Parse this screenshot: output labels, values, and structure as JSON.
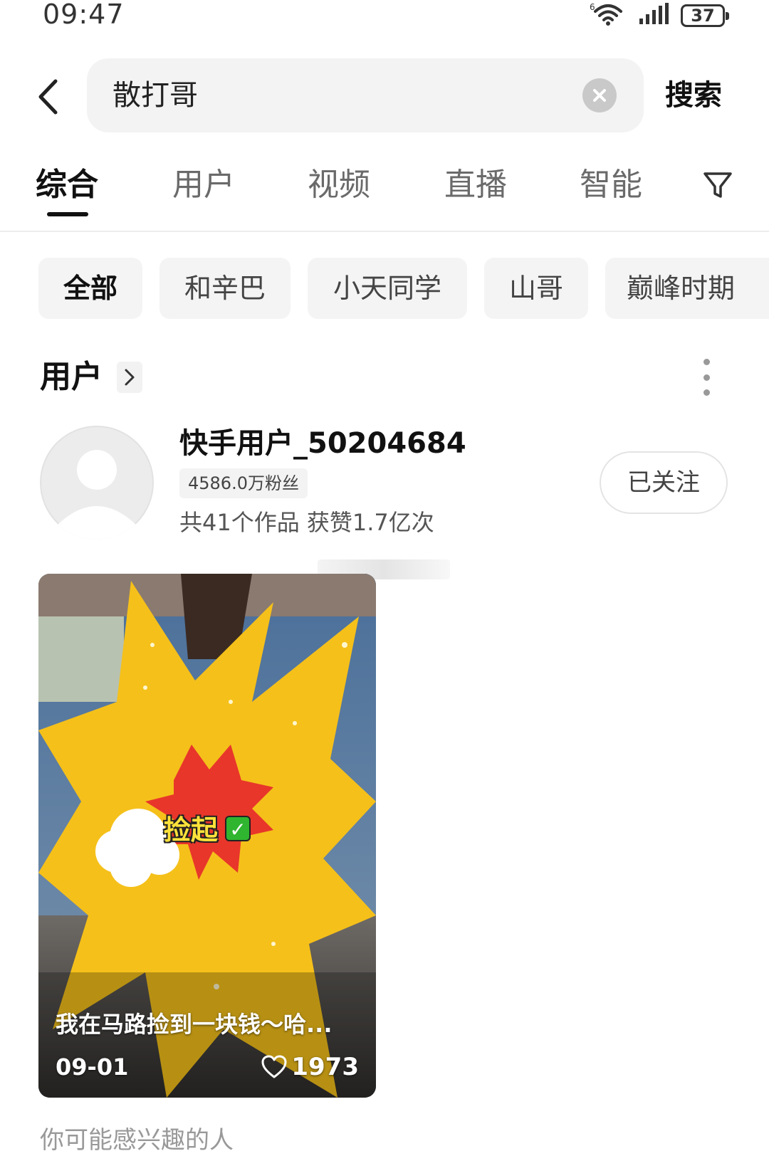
{
  "status_bar": {
    "time": "09:47",
    "battery": "37",
    "network_label": "6"
  },
  "search": {
    "query": "散打哥",
    "button_label": "搜索"
  },
  "tabs": [
    {
      "label": "综合",
      "active": true
    },
    {
      "label": "用户",
      "active": false
    },
    {
      "label": "视频",
      "active": false
    },
    {
      "label": "直播",
      "active": false
    },
    {
      "label": "智能",
      "active": false
    }
  ],
  "chips": [
    {
      "label": "全部",
      "active": true
    },
    {
      "label": "和辛巴",
      "active": false
    },
    {
      "label": "小天同学",
      "active": false
    },
    {
      "label": "山哥",
      "active": false
    },
    {
      "label": "巅峰时期",
      "active": false
    }
  ],
  "users_section": {
    "title": "用户"
  },
  "user": {
    "name": "快手用户_50204684",
    "fans": "4586.0万粉丝",
    "stats": "共41个作品 获赞1.7亿次",
    "follow_label": "已关注"
  },
  "video": {
    "title": "我在马路捡到一块钱～哈...",
    "date": "09-01",
    "likes": "1973",
    "sticker_text": "捡起"
  },
  "recommend": {
    "label": "你可能感兴趣的人"
  },
  "colors": {
    "sticker_yellow": "#f5c01a",
    "sticker_red": "#e8362b",
    "chip_bg": "#f4f4f4"
  }
}
